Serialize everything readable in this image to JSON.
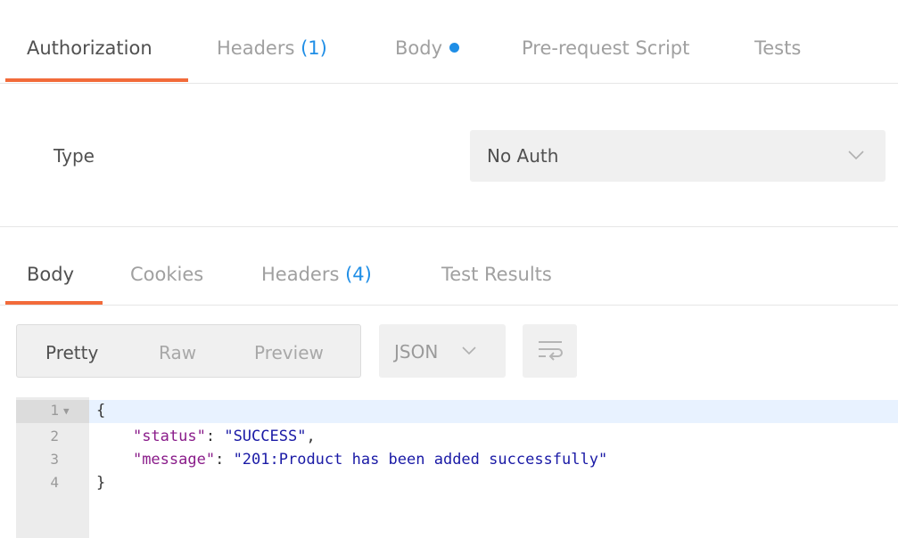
{
  "request_tabs": {
    "authorization": "Authorization",
    "headers": "Headers",
    "headers_count": "(1)",
    "body": "Body",
    "pre_request": "Pre-request Script",
    "tests": "Tests"
  },
  "auth": {
    "type_label": "Type",
    "type_value": "No Auth"
  },
  "response_tabs": {
    "body": "Body",
    "cookies": "Cookies",
    "headers": "Headers",
    "headers_count": "(4)",
    "test_results": "Test Results"
  },
  "view_modes": {
    "pretty": "Pretty",
    "raw": "Raw",
    "preview": "Preview"
  },
  "format": {
    "value": "JSON"
  },
  "code": {
    "line_numbers": [
      "1",
      "2",
      "3",
      "4"
    ],
    "open_brace": "{",
    "close_brace": "}",
    "status_key": "\"status\"",
    "status_value": "\"SUCCESS\"",
    "message_key": "\"message\"",
    "message_value": "\"201:Product has been added successfully\""
  },
  "colors": {
    "accent_underline": "#f26b3a",
    "count_blue": "#1f8ee6",
    "json_key": "#8a1c8a",
    "json_string": "#1a1aa6"
  },
  "icons": {
    "auth_dropdown": "chevron-down-icon",
    "format_dropdown": "chevron-down-icon",
    "wrap": "wrap-lines-icon",
    "fold": "fold-caret-icon",
    "body_modified": "dot-indicator-icon"
  }
}
